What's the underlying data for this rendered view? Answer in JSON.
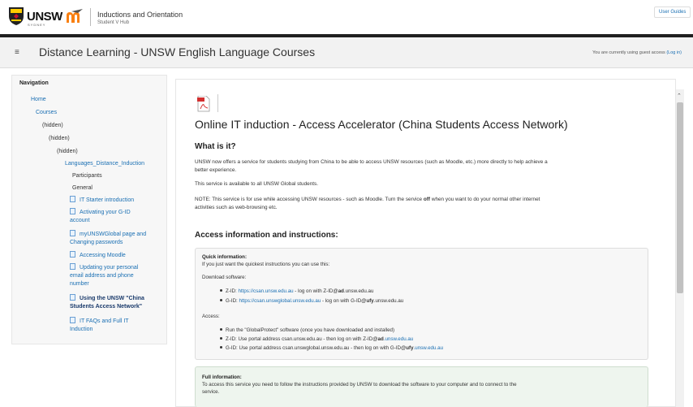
{
  "header": {
    "unsw_word": "UNSW",
    "unsw_sub": "SYDNEY",
    "site_title": "Inductions and Orientation",
    "site_sub": "Student V Hub",
    "user_guides": "User Guides"
  },
  "course": {
    "title": "Distance Learning - UNSW English Language Courses",
    "guest_note": "You are currently using guest access",
    "login_link": "(Log in)"
  },
  "navigation": {
    "heading": "Navigation",
    "items": [
      {
        "label": "Home"
      },
      {
        "label": "Courses"
      },
      {
        "label": "(hidden)"
      },
      {
        "label": "(hidden)"
      },
      {
        "label": "(hidden)"
      },
      {
        "label": "Languages_Distance_Induction"
      },
      {
        "label": "Participants"
      },
      {
        "label": "General"
      },
      {
        "label": "IT Starter introduction"
      },
      {
        "label": "Activating your G-ID",
        "label2": "account"
      },
      {
        "label": "myUNSWGlobal page and",
        "label2": "Changing passwords"
      },
      {
        "label": "Accessing Moodle"
      },
      {
        "label": "Updating your personal",
        "label2": "email address and phone",
        "label3": "number"
      },
      {
        "label": "Using the UNSW \"China",
        "label2": "Students Access Network\""
      },
      {
        "label": "IT FAQs and Full IT",
        "label2": "Induction"
      }
    ]
  },
  "content": {
    "title": "Online IT induction - Access Accelerator (China Students Access Network)",
    "what_heading": "What is it?",
    "p1a": "UNSW now offers a service for students studying from China to be able to access UNSW resources (such as Moodle, etc.) more directly to help achieve a",
    "p1b": "better experience.",
    "p2": "This service is available to all UNSW Global students.",
    "p3a_pre": "NOTE: This service is for use while accessing UNSW resources - such as Moodle. Turn the service ",
    "p3a_bold": "off",
    "p3a_post": " when you want to do your normal other internet",
    "p3b": "activities such as web-browsing etc.",
    "access_heading": "Access information and instructions:",
    "quick": {
      "heading": "Quick information:",
      "intro": "If you just want the quickest instructions you can use this:",
      "download_label": "Download software:",
      "zid_pre": "Z-ID: ",
      "zid_link": "https://csan.unsw.edu.au",
      "zid_mid": " - log on with Z-ID@",
      "zid_bold": "ad",
      "zid_post": ".unsw.edu.au",
      "gid_pre": "G-ID: ",
      "gid_link": "https://csan.unswglobal.unsw.edu.au",
      "gid_mid": " - log on with G-ID@",
      "gid_bold": "ufy",
      "gid_post": ".unsw.edu.au",
      "access_label": "Access:",
      "a1": "Run the \"GlobalProtect\" software (once you have downloaded and installed)",
      "a2_pre": "Z-ID: Use portal address csan.unsw.edu.au - then log on with Z-ID@",
      "a2_bold": "ad",
      "a2_link": ".unsw.edu.au",
      "a3_pre": "G-ID: Use portal address csan.unswglobal.unsw.edu.au - then log on with G-ID@",
      "a3_bold": "ufy",
      "a3_link": ".unsw.edu.au"
    },
    "full": {
      "heading": "Full information:",
      "line1": "To access this service you need to follow the instructions provided by UNSW to download the software to your computer and to connect to the",
      "line2": "service."
    }
  },
  "colors": {
    "link": "#1a6fb3",
    "dark_bar": "#1f1f1f",
    "unsw_yellow": "#ffcc00"
  }
}
